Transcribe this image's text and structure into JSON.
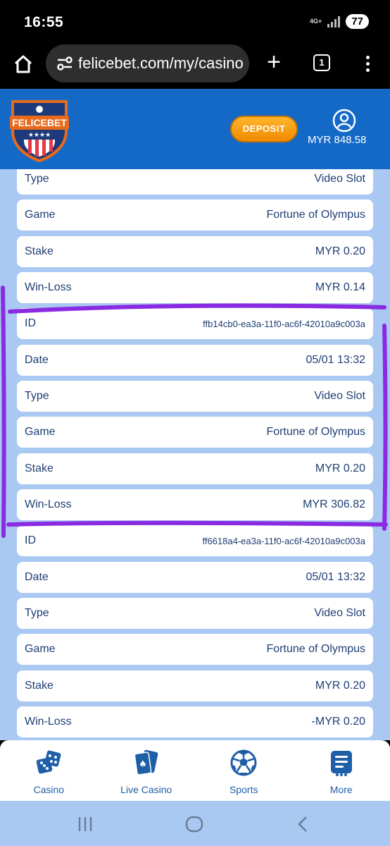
{
  "status_bar": {
    "time": "16:55",
    "network": "4G+",
    "battery": "77"
  },
  "browser": {
    "url": "felicebet.com/my/casino",
    "tab_count": "1"
  },
  "header": {
    "logo_text": "FELICEBET",
    "deposit_label": "DEPOSIT",
    "balance": "MYR 848.58"
  },
  "records": [
    {
      "label": "Type",
      "value": "Video Slot"
    },
    {
      "label": "Game",
      "value": "Fortune of Olympus"
    },
    {
      "label": "Stake",
      "value": "MYR 0.20"
    },
    {
      "label": "Win-Loss",
      "value": "MYR 0.14"
    },
    {
      "label": "ID",
      "value": "ffb14cb0-ea3a-11f0-ac6f-42010a9c003a"
    },
    {
      "label": "Date",
      "value": "05/01 13:32"
    },
    {
      "label": "Type",
      "value": "Video Slot"
    },
    {
      "label": "Game",
      "value": "Fortune of Olympus"
    },
    {
      "label": "Stake",
      "value": "MYR 0.20"
    },
    {
      "label": "Win-Loss",
      "value": "MYR 306.82"
    },
    {
      "label": "ID",
      "value": "ff6618a4-ea3a-11f0-ac6f-42010a9c003a"
    },
    {
      "label": "Date",
      "value": "05/01 13:32"
    },
    {
      "label": "Type",
      "value": "Video Slot"
    },
    {
      "label": "Game",
      "value": "Fortune of Olympus"
    },
    {
      "label": "Stake",
      "value": "MYR 0.20"
    },
    {
      "label": "Win-Loss",
      "value": "-MYR 0.20"
    }
  ],
  "bottom_nav": [
    {
      "label": "Casino",
      "icon": "dice-icon"
    },
    {
      "label": "Live Casino",
      "icon": "playing-cards-icon"
    },
    {
      "label": "Sports",
      "icon": "soccer-ball-icon"
    },
    {
      "label": "More",
      "icon": "more-list-icon"
    }
  ],
  "colors": {
    "header_blue": "#1469c7",
    "content_bg": "#a9c8f2",
    "text_navy": "#1f3e73",
    "deposit_orange": "#f5a01a",
    "annotation_purple": "#8a2be2"
  }
}
